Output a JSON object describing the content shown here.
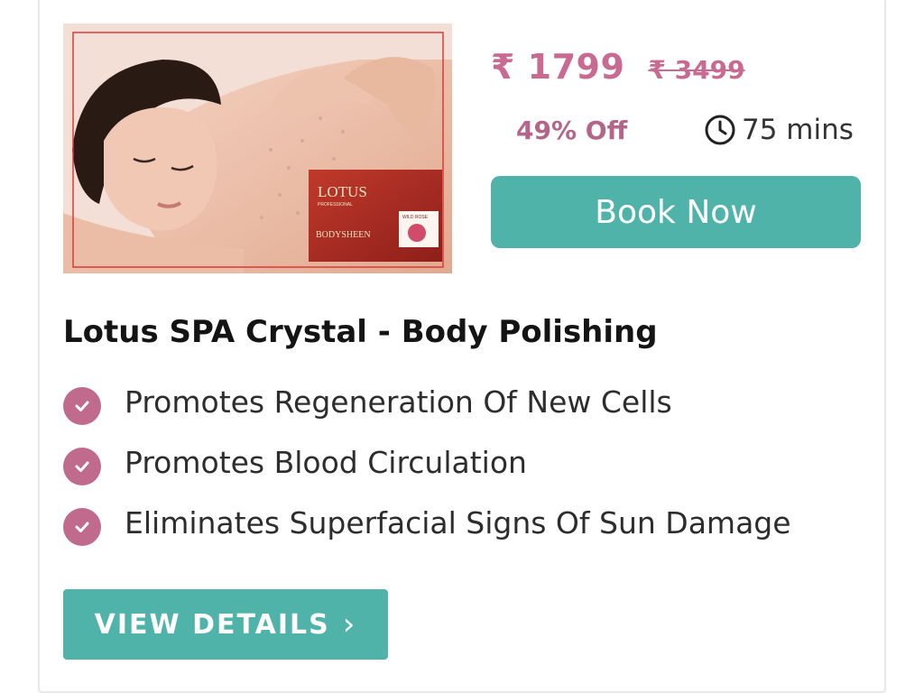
{
  "product": {
    "title": "Lotus SPA Crystal - Body Polishing",
    "image_brand": "LOTUS",
    "image_brand_sub": "PROFESSIONAL",
    "image_product": "BODYSHEEN",
    "image_variant": "WILD ROSE"
  },
  "pricing": {
    "current": "₹ 1799",
    "original": "₹ 3499",
    "discount": "49% Off",
    "duration": "75 mins",
    "accent_color": "#c86a91"
  },
  "actions": {
    "book_label": "Book Now",
    "view_label": "VIEW DETAILS",
    "view_chevron": "›",
    "button_color": "#4fb3aa"
  },
  "features": [
    {
      "text": "Promotes Regeneration Of New Cells",
      "icon": "check-circle-icon"
    },
    {
      "text": "Promotes Blood Circulation",
      "icon": "check-circle-icon"
    },
    {
      "text": "Eliminates Superfacial Signs Of Sun Damage",
      "icon": "check-circle-icon"
    }
  ]
}
